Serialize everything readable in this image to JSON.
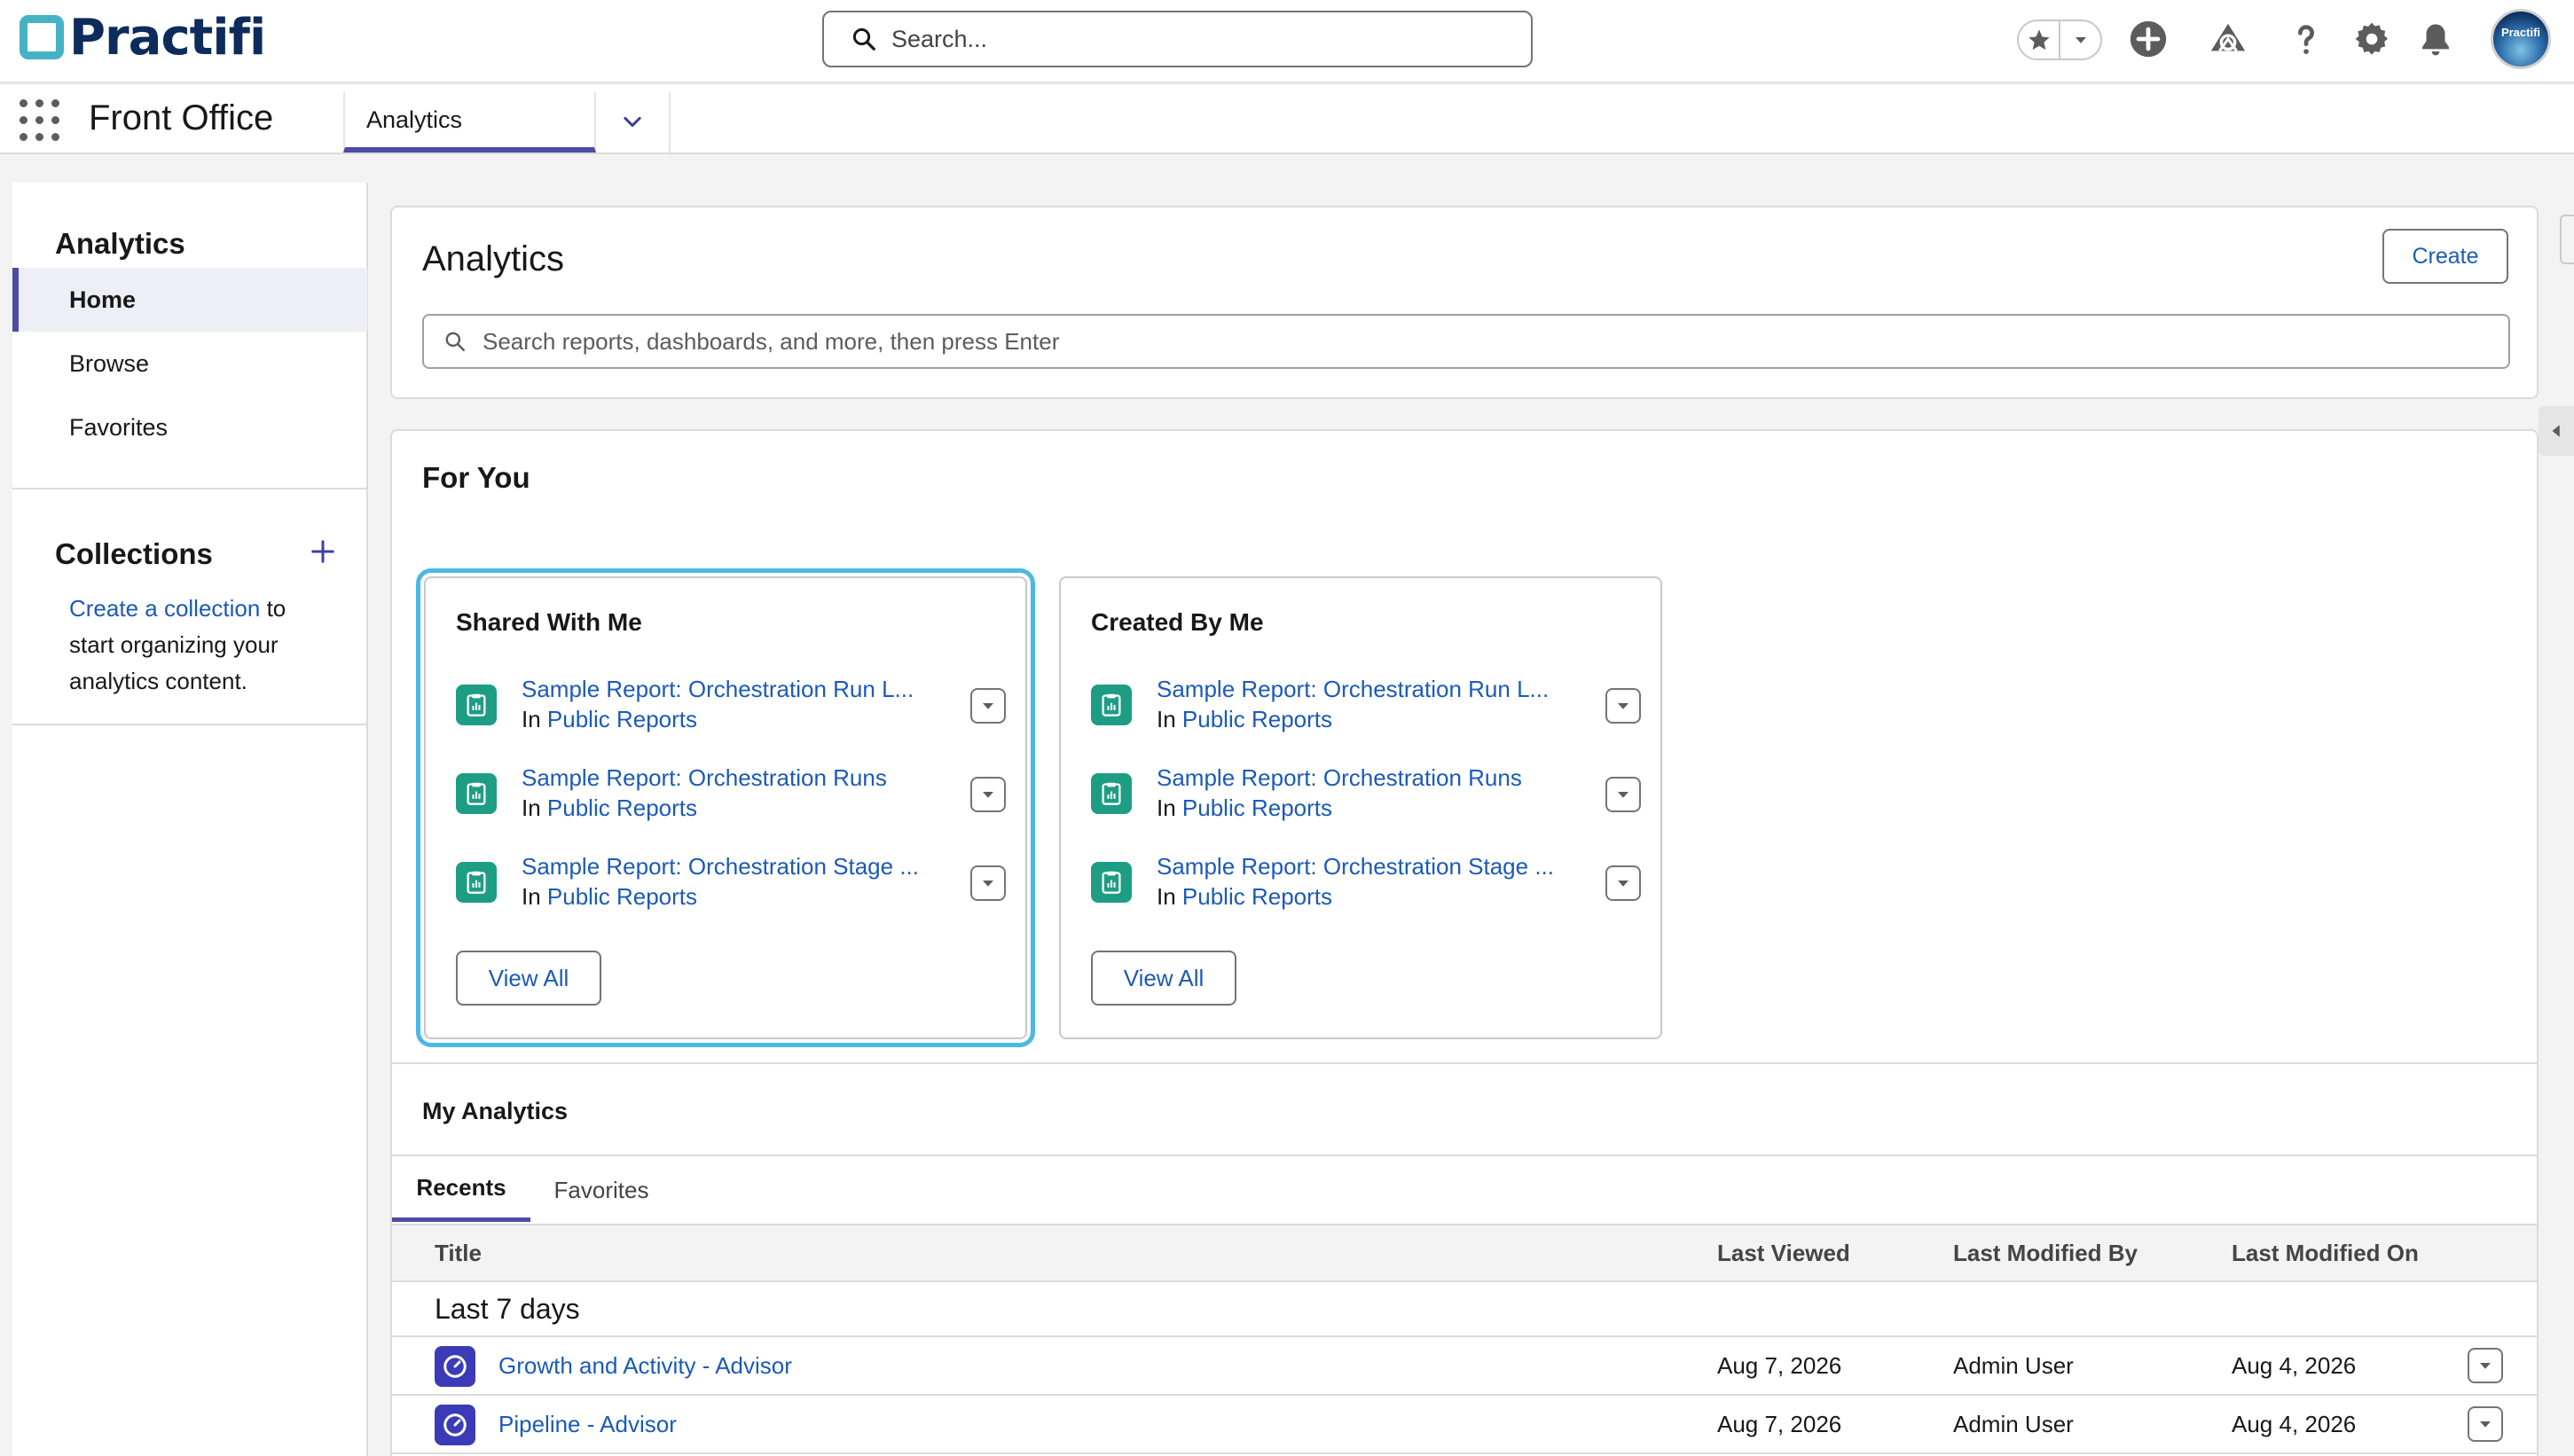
{
  "header": {
    "logo_text": "Practifi",
    "search_placeholder": "Search...",
    "avatar_text": "Practifi"
  },
  "appnav": {
    "app_name": "Front Office",
    "active_tab": "Analytics"
  },
  "sidebar": {
    "title": "Analytics",
    "items": [
      {
        "label": "Home",
        "active": true
      },
      {
        "label": "Browse",
        "active": false
      },
      {
        "label": "Favorites",
        "active": false
      }
    ],
    "collections": {
      "title": "Collections",
      "link_text": "Create a collection",
      "rest_text": " to start organizing your analytics content."
    }
  },
  "analytics_header": {
    "title": "Analytics",
    "create_label": "Create",
    "search_placeholder": "Search reports, dashboards, and more, then press Enter"
  },
  "for_you": {
    "title": "For You",
    "cards": [
      {
        "title": "Shared With Me",
        "items": [
          {
            "name": "Sample Report: Orchestration Run L...",
            "in_label": "In",
            "folder": "Public Reports"
          },
          {
            "name": "Sample Report: Orchestration Runs",
            "in_label": "In",
            "folder": "Public Reports"
          },
          {
            "name": "Sample Report: Orchestration Stage ...",
            "in_label": "In",
            "folder": "Public Reports"
          }
        ],
        "view_all": "View All"
      },
      {
        "title": "Created By Me",
        "items": [
          {
            "name": "Sample Report: Orchestration Run L...",
            "in_label": "In",
            "folder": "Public Reports"
          },
          {
            "name": "Sample Report: Orchestration Runs",
            "in_label": "In",
            "folder": "Public Reports"
          },
          {
            "name": "Sample Report: Orchestration Stage ...",
            "in_label": "In",
            "folder": "Public Reports"
          }
        ],
        "view_all": "View All"
      }
    ]
  },
  "my_analytics": {
    "title": "My Analytics",
    "tabs": [
      "Recents",
      "Favorites"
    ],
    "columns": [
      "Title",
      "Last Viewed",
      "Last Modified By",
      "Last Modified On"
    ],
    "group_label": "Last 7 days",
    "rows": [
      {
        "title": "Growth and Activity - Advisor",
        "last_viewed": "Aug 7, 2026",
        "modified_by": "Admin User",
        "modified_on": "Aug 4, 2026"
      },
      {
        "title": "Pipeline - Advisor",
        "last_viewed": "Aug 7, 2026",
        "modified_by": "Admin User",
        "modified_on": "Aug 4, 2026"
      }
    ]
  },
  "colors": {
    "brand_navy": "#0d2c5c",
    "brand_teal": "#45b3c4",
    "accent": "#4d4ba6",
    "link": "#1b5ab8",
    "report_icon": "#1d9d84",
    "dashboard_icon": "#3b3bb8",
    "focus": "#4bb8e6"
  }
}
